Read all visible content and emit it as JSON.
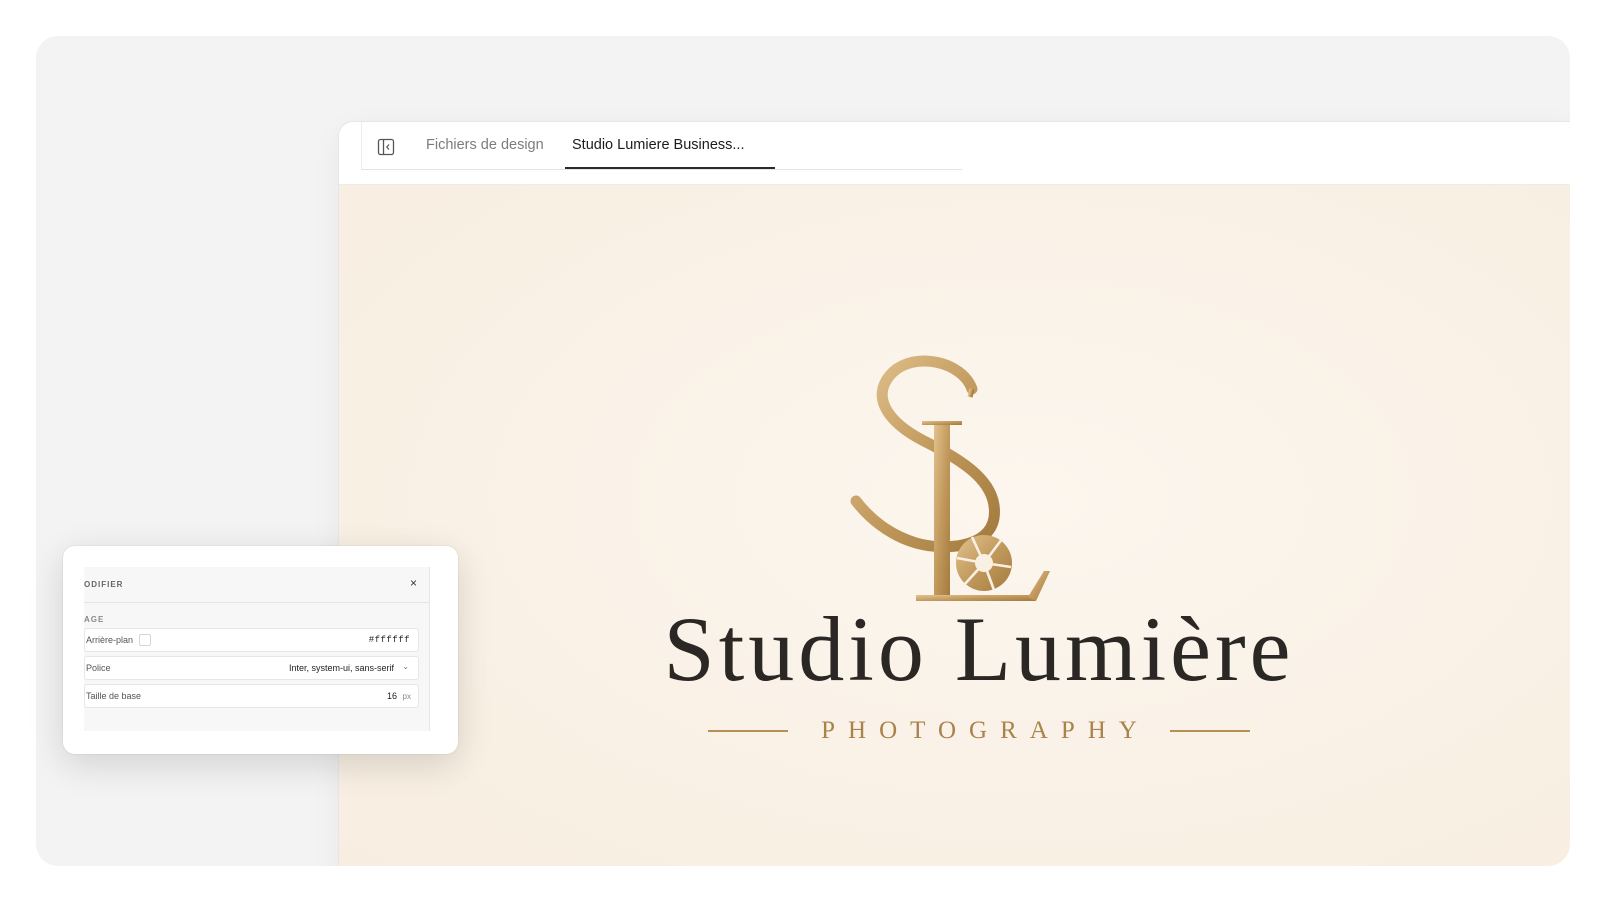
{
  "tabs": {
    "files_label": "Fichiers de design",
    "active_label": "Studio Lumiere Business..."
  },
  "canvas": {
    "brand_name": "Studio Lumière",
    "tagline": "PHOTOGRAPHY",
    "monogram_letters": "SL",
    "colors": {
      "gold": "#b68f55",
      "ink": "#2a2724",
      "background": "#f9f0e4"
    }
  },
  "panel": {
    "title": "ODIFIER",
    "close_glyph": "×",
    "section": "AGE",
    "fields": [
      {
        "label": "Arrière-plan",
        "value": "#ffffff"
      },
      {
        "label": "Police",
        "value": "Inter, system-ui, sans-serif"
      },
      {
        "label": "Taille de base",
        "value": "16",
        "unit": "px"
      }
    ]
  },
  "icons": {
    "sidebar_toggle": "sidebar-toggle-icon",
    "close": "close-icon",
    "dropdown": "chevron-down-icon",
    "aperture": "camera-aperture-icon"
  }
}
